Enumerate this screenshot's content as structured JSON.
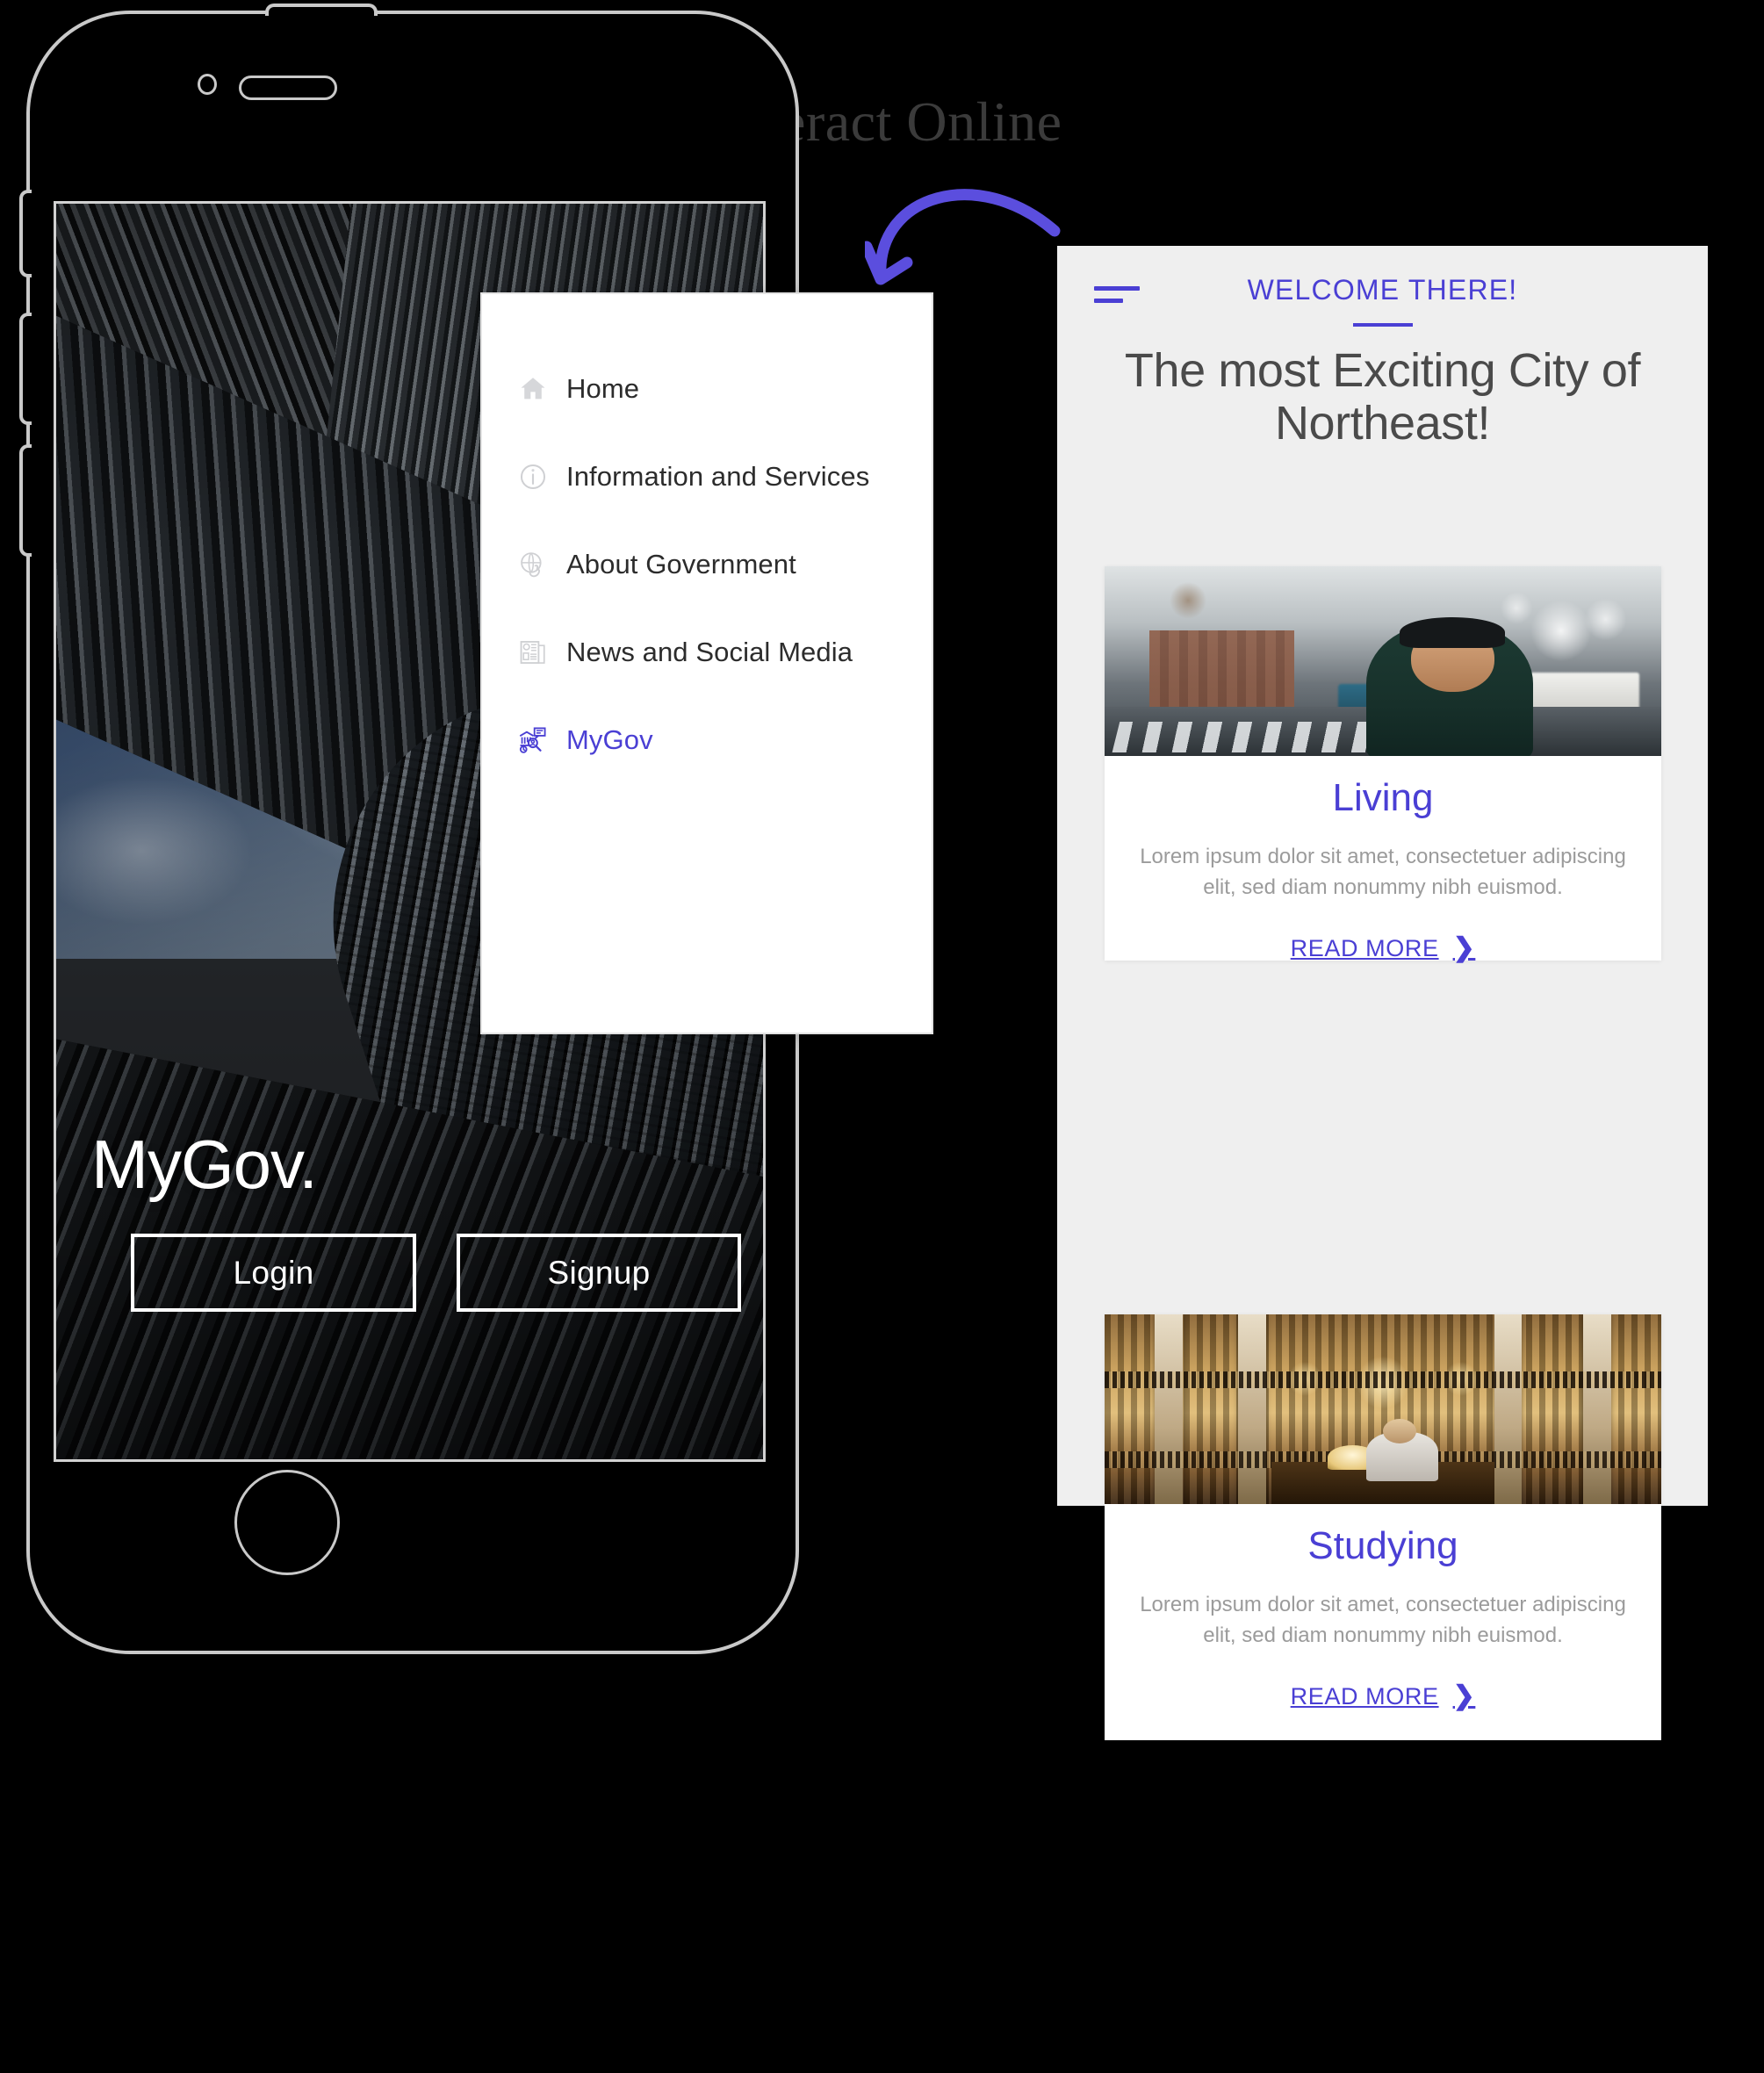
{
  "headline": "Interact Online",
  "phone": {
    "hero_brand": "MyGov.",
    "login_label": "Login",
    "signup_label": "Signup",
    "icons": {
      "camera": "camera-icon",
      "speaker": "speaker-grill-icon",
      "home_button": "home-button-icon"
    }
  },
  "menu": {
    "items": [
      {
        "label": "Home",
        "icon": "house-icon",
        "active": false
      },
      {
        "label": "Information and Services",
        "icon": "info-circle-icon",
        "active": false
      },
      {
        "label": "About Government",
        "icon": "globe-hand-icon",
        "active": false
      },
      {
        "label": "News and Social Media",
        "icon": "newspaper-icon",
        "active": false
      },
      {
        "label": "MyGov",
        "icon": "government-search-icon",
        "active": true
      }
    ]
  },
  "preview": {
    "hamburger_icon": "hamburger-menu-icon",
    "eyebrow": "WELCOME THERE!",
    "title": "The most Exciting City of Northeast!",
    "cards": [
      {
        "title": "Living",
        "description": "Lorem ipsum dolor sit amet, consectetuer adipiscing elit, sed diam nonummy nibh euismod.",
        "cta": "READ MORE",
        "cta_icon": "chevron-right-icon",
        "photo": "street-portrait-photo"
      },
      {
        "title": "Studying",
        "description": "Lorem ipsum dolor sit amet, consectetuer adipiscing elit, sed diam nonummy nibh euismod.",
        "cta": "READ MORE",
        "cta_icon": "chevron-right-icon",
        "photo": "library-interior-photo"
      }
    ]
  },
  "annotation": {
    "arrow_icon": "curved-arrow-icon"
  },
  "colors": {
    "accent_purple": "#4a3fd4",
    "background": "#000000",
    "preview_bg": "#efefef",
    "card_bg": "#ffffff",
    "body_text": "#9b9b9b",
    "heading_text": "#4a4a4a",
    "headline_text": "#3b3b3b"
  }
}
